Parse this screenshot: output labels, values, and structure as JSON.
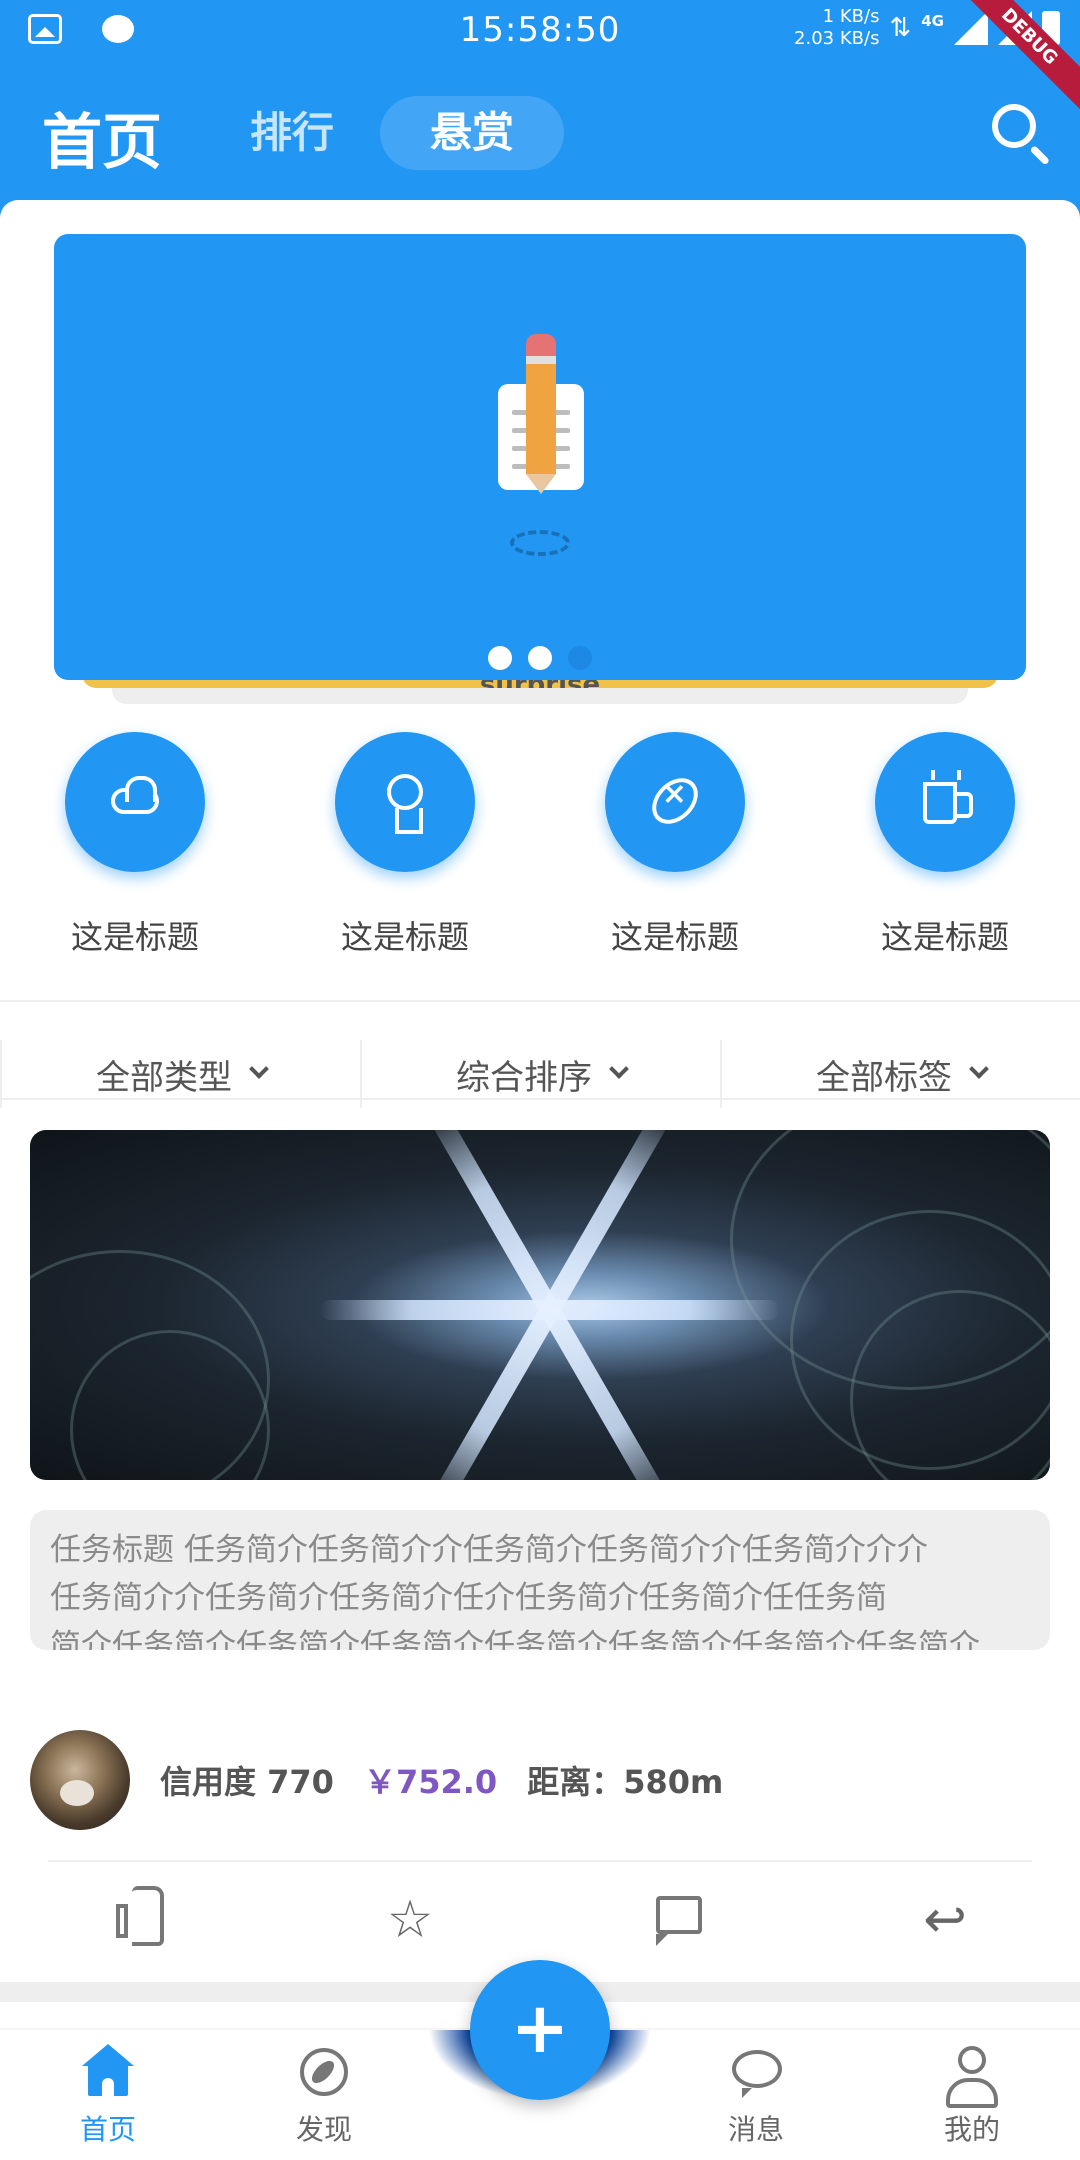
{
  "status_bar": {
    "time": "15:58:50",
    "speed_up": "1 KB/s",
    "speed_down": "2.03 KB/s",
    "network": "4G",
    "debug": "DEBUG"
  },
  "app_bar": {
    "title": "首页",
    "tabs": [
      {
        "label": "排行",
        "active": false
      },
      {
        "label": "悬赏",
        "active": true
      }
    ],
    "search_icon": "search-icon"
  },
  "banner": {
    "icon": "pencil-note-icon",
    "caption_peek": "surprise",
    "page_indicator": {
      "count": 3,
      "active_index": 0
    }
  },
  "quick_entries": [
    {
      "label": "这是标题",
      "icon": "cloud-icon"
    },
    {
      "label": "这是标题",
      "icon": "award-icon"
    },
    {
      "label": "这是标题",
      "icon": "football-icon"
    },
    {
      "label": "这是标题",
      "icon": "coffee-cup-icon"
    }
  ],
  "filters": [
    {
      "label": "全部类型"
    },
    {
      "label": "综合排序"
    },
    {
      "label": "全部标签"
    }
  ],
  "task_card": {
    "image": "snowflake-photo",
    "description_lines": [
      "任务标题  任务简介任务简介介任务简介任务简介介任务简介介介",
      "任务简介介任务简介任务简介任介任务简介任务简介任任务简",
      "简介任务简介任务简介任务简介任务简介任务简介任务简介任务简介任…"
    ],
    "credit_label": "信用度 770",
    "price": "￥752.0",
    "distance": "距离：580m",
    "actions": [
      "like-icon",
      "star-icon",
      "comment-icon",
      "reply-icon"
    ]
  },
  "fab": {
    "label": "+"
  },
  "bottom_nav": [
    {
      "label": "首页",
      "icon": "home-icon",
      "active": true
    },
    {
      "label": "发现",
      "icon": "compass-icon",
      "active": false
    },
    {
      "label": "消息",
      "icon": "message-icon",
      "active": false
    },
    {
      "label": "我的",
      "icon": "user-icon",
      "active": false
    }
  ],
  "colors": {
    "primary": "#2196F3",
    "price": "#7E57C2",
    "debug_ribbon": "#B71C3C"
  }
}
